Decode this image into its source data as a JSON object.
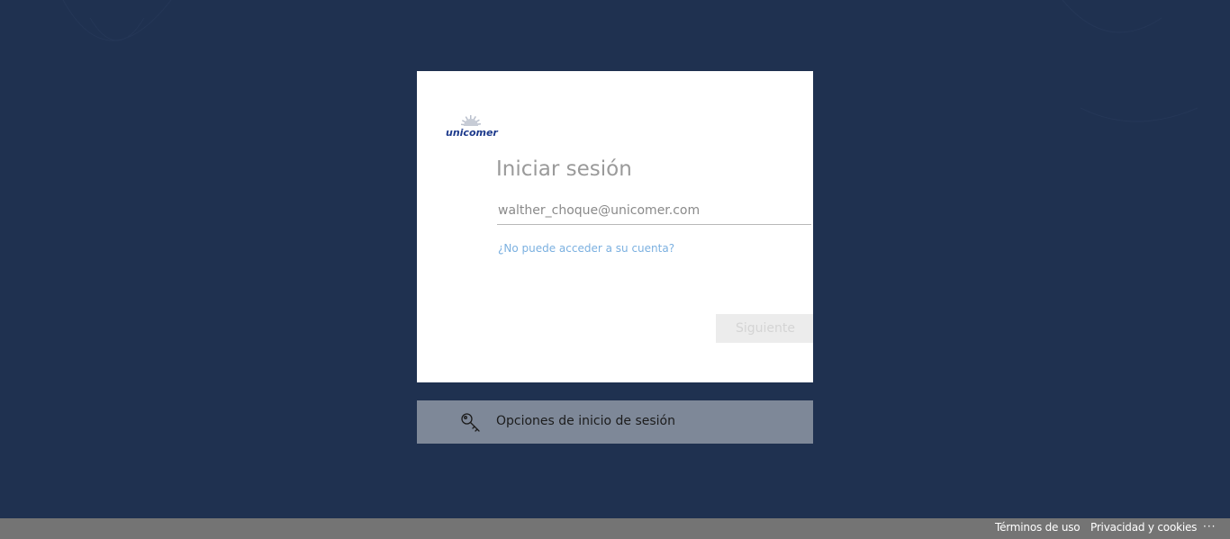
{
  "signin": {
    "logo_text": "unicomer",
    "title": "Iniciar sesión",
    "email_value": "walther_choque@unicomer.com",
    "help_link": "¿No puede acceder a su cuenta?",
    "next_label": "Siguiente"
  },
  "options": {
    "label": "Opciones de inicio de sesión",
    "icon": "key-icon"
  },
  "footer": {
    "terms": "Términos de uso",
    "privacy": "Privacidad y cookies",
    "more": "···"
  },
  "colors": {
    "background": "#1f3150",
    "card": "#ffffff",
    "link": "#7bb0e0",
    "options_bar": "#7e8898",
    "footer": "#747474"
  }
}
